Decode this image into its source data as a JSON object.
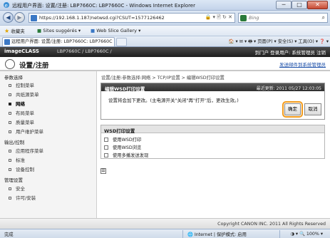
{
  "window": {
    "title": "远程用户界面: 设置/注册: LBP7660C: LBP7660C - Windows Internet Explorer",
    "min": "─",
    "max": "□",
    "close": "✕"
  },
  "addressbar": {
    "url": "https://192.168.1.187/netwsd.cgi?CSUT=1577126462",
    "tools": "🔒 ▾ 🖹 ↻ ✕",
    "search_placeholder": "Bing",
    "search_icon": "⌕"
  },
  "favorites": {
    "label": "收藏夹",
    "items": [
      "Sites suggérés ▾",
      "Web Slice Gallery ▾"
    ]
  },
  "tab": {
    "title": "远程用户界面: 设置/注册: LBP7660C: LBP7660C",
    "commands": "🏠 ▾  ✉ ▾  🖶 ▾  页面(P) ▾  安全(S) ▾  工具(O) ▾  ❓ ▾"
  },
  "page": {
    "brand": "imageCLASS",
    "model": "LBP7660C / LBP7660C /",
    "top_right": "到门户  登录用户: 系统管理员  注销",
    "header_title": "设置/注册",
    "header_link": "发送邮件到系统管理员"
  },
  "sidebar": {
    "groups": [
      {
        "head": "参数选择",
        "items": [
          "控制菜单",
          "共纸源菜单",
          "网络",
          "布局菜单",
          "质量菜单",
          "用户维护菜单"
        ]
      },
      {
        "head": "输出/控制",
        "items": [
          "应用程序菜单",
          "标准",
          "设备控制"
        ]
      },
      {
        "head": "管理设置",
        "items": [
          "安全",
          "许可/安装"
        ]
      }
    ],
    "selected": "网络"
  },
  "main": {
    "breadcrumb": "设置/注册:参数选择:网络 > TCP/IP设置 > 编辑WSD打印设置",
    "panel_title": "编辑WSD打印设置",
    "last_updated": "最近更新: 2011 05/27 12:03:05",
    "note": "设置将会加下更改。(主电源开关\"关闭\"再\"打开\"后，更改生效。)",
    "ok_label": "确定",
    "cancel_label": "取消",
    "wsd_title": "WSD打印设置",
    "options": [
      "使用WSD打印",
      "使用WSD浏览",
      "使用多播发送发现"
    ],
    "top_link": "☰"
  },
  "footer": {
    "copyright": "Copyright CANON INC. 2011 All Rights Reserved"
  },
  "statusbar": {
    "left": "完成",
    "zone": "🌐 Internet | 保护模式: 启用",
    "zoom": "◑ ▾  🔍 100%  ▾"
  }
}
